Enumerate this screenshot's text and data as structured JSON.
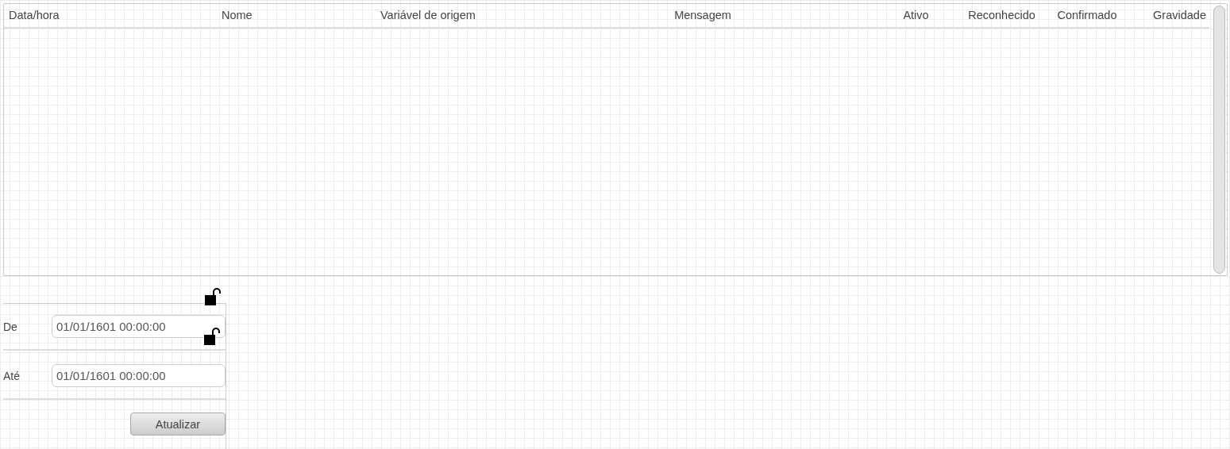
{
  "table": {
    "columns": [
      "Data/hora",
      "Nome",
      "Variável de origem",
      "Mensagem",
      "Ativo",
      "Reconhecido",
      "Confirmado",
      "Gravidade"
    ]
  },
  "filters": [
    {
      "label": "De",
      "value": "01/01/1601 00:00:00"
    },
    {
      "label": "Até",
      "value": "01/01/1601 00:00:00"
    }
  ],
  "buttons": [
    "Atualizar"
  ]
}
